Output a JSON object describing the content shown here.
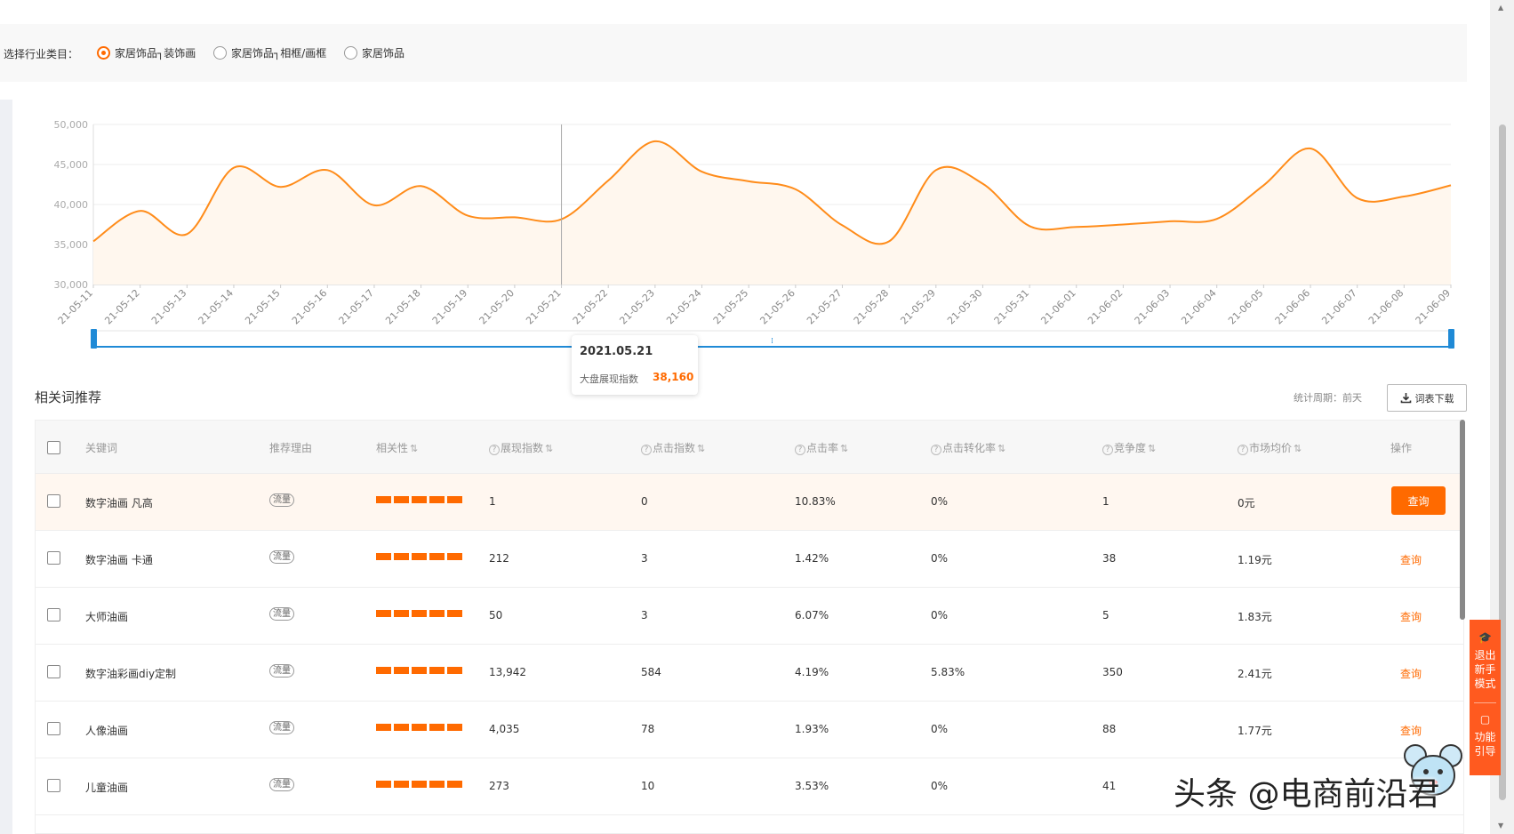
{
  "filter": {
    "label": "选择行业类目：",
    "options": [
      {
        "label": "家居饰品┐装饰画",
        "checked": true
      },
      {
        "label": "家居饰品┐相框/画框",
        "checked": false
      },
      {
        "label": "家居饰品",
        "checked": false
      }
    ]
  },
  "chart_data": {
    "type": "area",
    "title": "",
    "xlabel": "",
    "ylabel": "",
    "ylim": [
      30000,
      50000
    ],
    "yticks": [
      "30,000",
      "35,000",
      "40,000",
      "45,000",
      "50,000"
    ],
    "x": [
      "21-05-11",
      "21-05-12",
      "21-05-13",
      "21-05-14",
      "21-05-15",
      "21-05-16",
      "21-05-17",
      "21-05-18",
      "21-05-19",
      "21-05-20",
      "21-05-21",
      "21-05-22",
      "21-05-23",
      "21-05-24",
      "21-05-25",
      "21-05-26",
      "21-05-27",
      "21-05-28",
      "21-05-29",
      "21-05-30",
      "21-05-31",
      "21-06-01",
      "21-06-02",
      "21-06-03",
      "21-06-04",
      "21-06-05",
      "21-06-06",
      "21-06-07",
      "21-06-08",
      "21-06-09"
    ],
    "series": [
      {
        "name": "大盘展现指数",
        "color": "#ff8c1a",
        "values": [
          35400,
          39200,
          36300,
          44600,
          42200,
          44300,
          39900,
          42300,
          38600,
          38400,
          38160,
          43000,
          47900,
          44100,
          42900,
          41900,
          37400,
          35400,
          44300,
          42600,
          37300,
          37200,
          37500,
          37900,
          38200,
          42400,
          47000,
          40800,
          41000,
          42400
        ]
      }
    ],
    "grid": true,
    "legend": "none",
    "tooltip": {
      "date": "2021.05.21",
      "label": "大盘展现指数",
      "value": "38,160",
      "index": 10
    }
  },
  "section": {
    "title": "相关词推荐",
    "period": "统计周期：前天",
    "download": "词表下载"
  },
  "table": {
    "headers": {
      "keyword": "关键词",
      "reason": "推荐理由",
      "relevance": "相关性",
      "impressions": "展现指数",
      "clicks": "点击指数",
      "ctr": "点击率",
      "cvr": "点击转化率",
      "competition": "竞争度",
      "price": "市场均价",
      "action": "操作"
    },
    "rows": [
      {
        "keyword": "数字油画 凡高",
        "reason": "流量",
        "impressions": "1",
        "clicks": "0",
        "ctr": "10.83%",
        "cvr": "0%",
        "competition": "1",
        "price": "0元",
        "action": "查询",
        "highlighted": true
      },
      {
        "keyword": "数字油画 卡通",
        "reason": "流量",
        "impressions": "212",
        "clicks": "3",
        "ctr": "1.42%",
        "cvr": "0%",
        "competition": "38",
        "price": "1.19元",
        "action": "查询",
        "highlighted": false
      },
      {
        "keyword": "大师油画",
        "reason": "流量",
        "impressions": "50",
        "clicks": "3",
        "ctr": "6.07%",
        "cvr": "0%",
        "competition": "5",
        "price": "1.83元",
        "action": "查询",
        "highlighted": false
      },
      {
        "keyword": "数字油彩画diy定制",
        "reason": "流量",
        "impressions": "13,942",
        "clicks": "584",
        "ctr": "4.19%",
        "cvr": "5.83%",
        "competition": "350",
        "price": "2.41元",
        "action": "查询",
        "highlighted": false
      },
      {
        "keyword": "人像油画",
        "reason": "流量",
        "impressions": "4,035",
        "clicks": "78",
        "ctr": "1.93%",
        "cvr": "0%",
        "competition": "88",
        "price": "1.77元",
        "action": "查询",
        "highlighted": false
      },
      {
        "keyword": "儿童油画",
        "reason": "流量",
        "impressions": "273",
        "clicks": "10",
        "ctr": "3.53%",
        "cvr": "0%",
        "competition": "41",
        "price": "",
        "action": "",
        "highlighted": false
      }
    ]
  },
  "side_panel": {
    "exit_label": "退出新手模式",
    "guide_label": "功能引导"
  },
  "watermark": "头条 @电商前沿君",
  "colors": {
    "accent": "#ff6a00",
    "line": "#ff8c1a",
    "area": "#fff7ee"
  }
}
